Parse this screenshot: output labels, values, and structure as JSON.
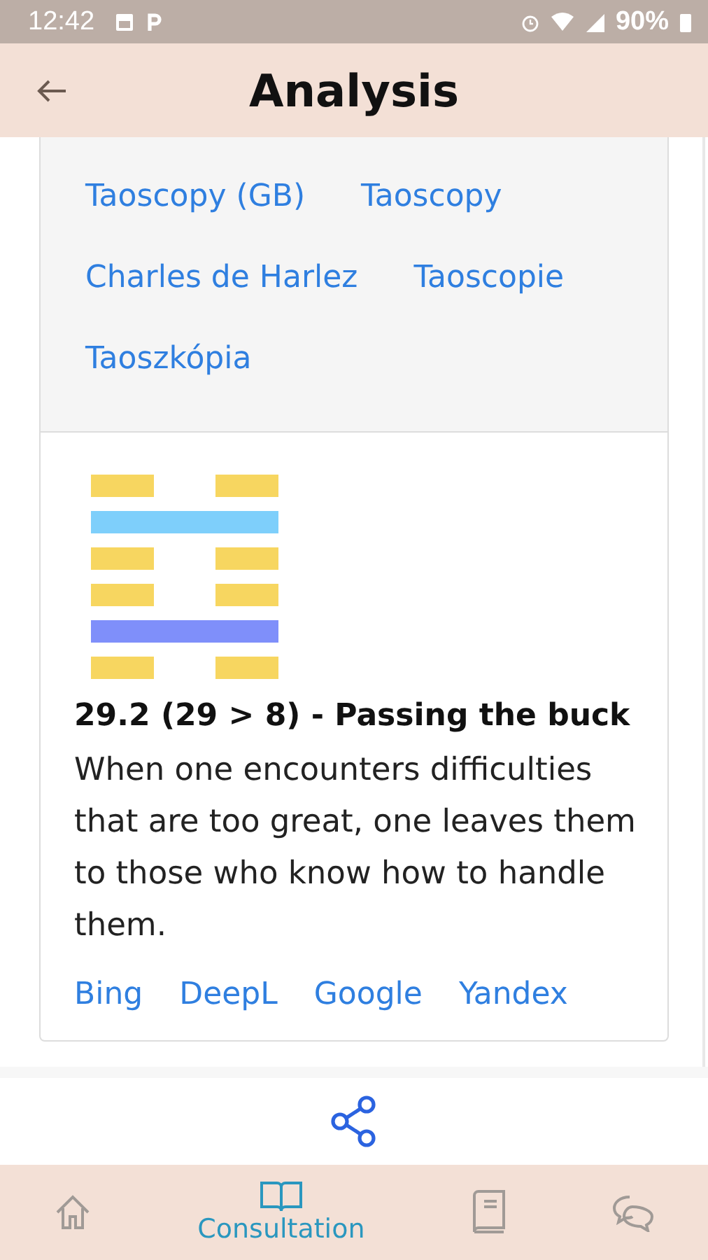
{
  "status_bar": {
    "time": "12:42",
    "battery": "90%"
  },
  "header": {
    "title": "Analysis"
  },
  "sources": [
    {
      "label": "Taoscopy (GB)"
    },
    {
      "label": "Taoscopy"
    },
    {
      "label": "Charles de Harlez"
    },
    {
      "label": "Taoscopie"
    },
    {
      "label": "Taoszkópia"
    }
  ],
  "hexagram": {
    "lines": [
      {
        "kind": "broken",
        "color": "#f7d660"
      },
      {
        "kind": "solid",
        "color": "#7ecffb"
      },
      {
        "kind": "broken",
        "color": "#f7d660"
      },
      {
        "kind": "broken",
        "color": "#f7d660"
      },
      {
        "kind": "solid",
        "color": "#7f8ffa"
      },
      {
        "kind": "broken",
        "color": "#f7d660"
      }
    ],
    "title": "29.2 (29 > 8) - Passing the buck",
    "text": "When one encounters difficulties that are too great, one leaves them to those who know how to handle them.",
    "translators": [
      "Bing",
      "DeepL",
      "Google",
      "Yandex"
    ]
  },
  "nav": [
    {
      "kind": "home",
      "selected": false
    },
    {
      "kind": "book-open",
      "label": "Consultation",
      "selected": true
    },
    {
      "kind": "book",
      "selected": false
    },
    {
      "kind": "chat",
      "selected": false
    }
  ]
}
